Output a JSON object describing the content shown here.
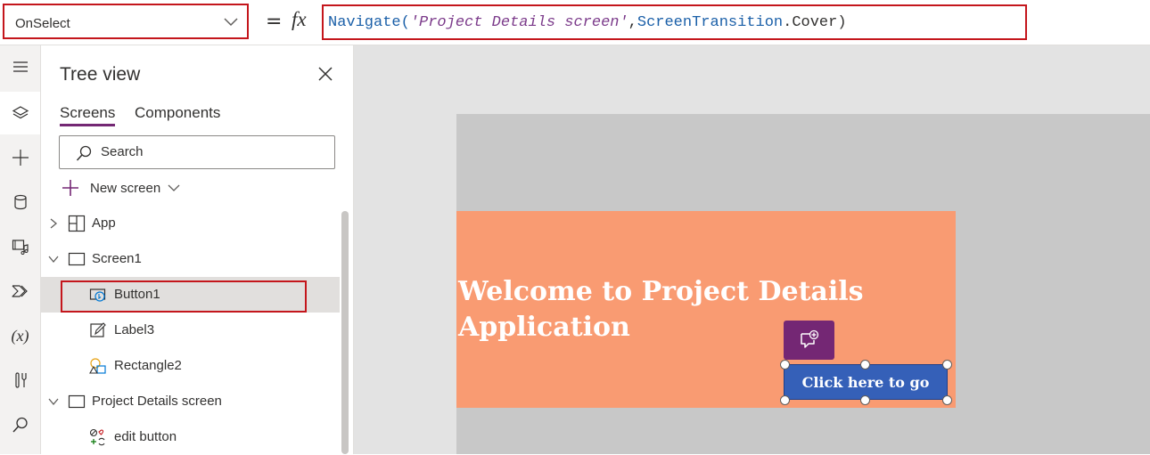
{
  "formula_bar": {
    "property": "OnSelect",
    "equals": "=",
    "fx": "fx",
    "formula": {
      "fn": "Navigate(",
      "arg1": "'Project Details screen'",
      "comma": ",",
      "arg2": "ScreenTransition",
      "dot": ".",
      "arg3": "Cover",
      "close": ")"
    }
  },
  "rail": {
    "items": [
      "hamburger-icon",
      "layers-icon",
      "plus-icon",
      "database-icon",
      "media-icon",
      "flow-icon",
      "variables-icon",
      "tools-icon",
      "search-icon"
    ],
    "variables_text": "(x)"
  },
  "tree_view": {
    "title": "Tree view",
    "tabs": [
      "Screens",
      "Components"
    ],
    "search_placeholder": "Search",
    "new_screen_label": "New screen",
    "items": [
      {
        "label": "App"
      },
      {
        "label": "Screen1"
      },
      {
        "label": "Button1"
      },
      {
        "label": "Label3"
      },
      {
        "label": "Rectangle2"
      },
      {
        "label": "Project Details screen"
      },
      {
        "label": "edit button"
      }
    ]
  },
  "canvas": {
    "welcome_text": "Welcome to Project Details Application",
    "button_text": "Click here to go"
  },
  "colors": {
    "accent": "#742774",
    "highlight_border": "#c4161c",
    "banner": "#f99b72",
    "button": "#3560b8"
  }
}
